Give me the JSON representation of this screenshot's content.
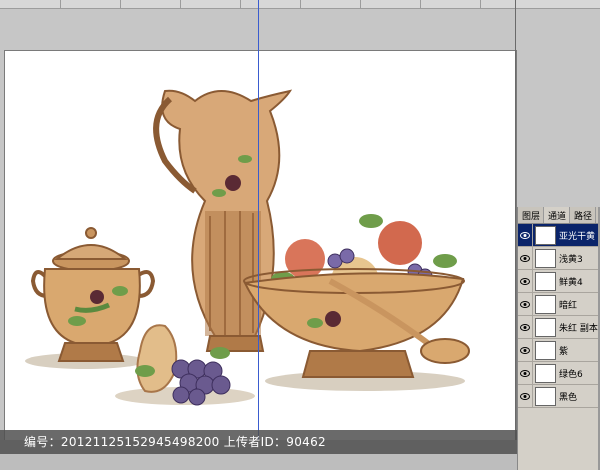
{
  "canvas_caption": "编号：20121125152945498200 上传者ID：90462",
  "channels_panel": {
    "tabs": [
      {
        "label": "图层",
        "active": false
      },
      {
        "label": "通道",
        "active": true
      },
      {
        "label": "路径",
        "active": false
      }
    ],
    "channels": [
      {
        "name": "亚光干黄",
        "selected": true
      },
      {
        "name": "浅黄3",
        "selected": false
      },
      {
        "name": "鲜黄4",
        "selected": false
      },
      {
        "name": "暗红",
        "selected": false
      },
      {
        "name": "朱红 副本",
        "selected": false
      },
      {
        "name": "紫",
        "selected": false
      },
      {
        "name": "绿色6",
        "selected": false
      },
      {
        "name": "黑色",
        "selected": false
      }
    ]
  },
  "colors": {
    "canvas_bg": "#ffffff",
    "workspace": "#c6c6c6",
    "guide": "#3a5ccf",
    "selection": "#0a246a"
  }
}
